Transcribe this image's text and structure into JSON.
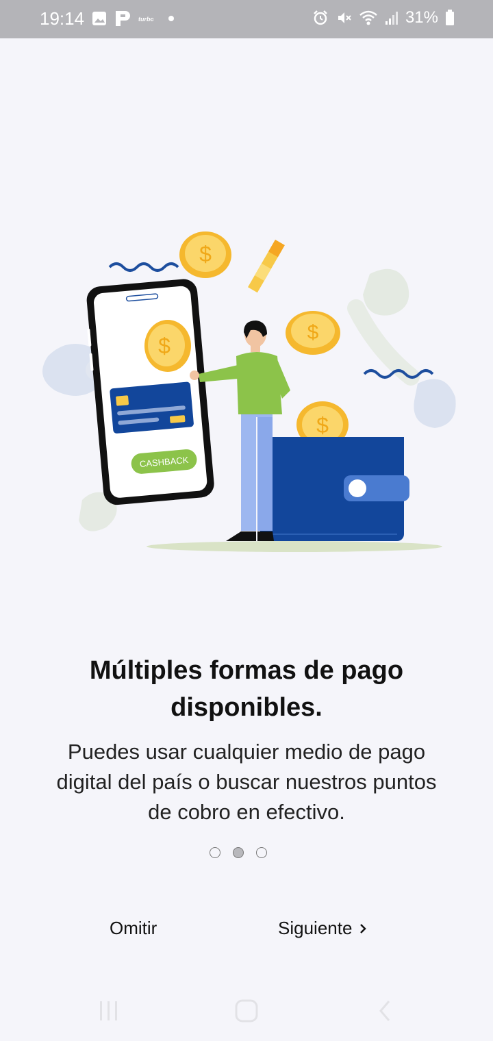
{
  "status_bar": {
    "time": "19:14",
    "battery": "31%",
    "icons": [
      "image-icon",
      "p-app-icon",
      "turbo-icon",
      "notification-dot-icon",
      "alarm-icon",
      "mute-icon",
      "wifi-icon",
      "signal-icon",
      "battery-icon"
    ]
  },
  "illustration": {
    "cashback_label": "CASHBACK",
    "accent_green": "#8cc34a",
    "accent_blue": "#12469b",
    "coin_color": "#f7c948"
  },
  "onboarding": {
    "title_line1": "Múltiples formas de pago",
    "title_line2": "disponibles.",
    "subtitle_line1": "Puedes usar cualquier medio de pago",
    "subtitle_line2": "digital del país o buscar nuestros puntos",
    "subtitle_line3": "de cobro en efectivo.",
    "page_total": 3,
    "page_current": 2
  },
  "actions": {
    "skip_label": "Omitir",
    "next_label": "Siguiente",
    "next_icon": "chevron-right-icon"
  },
  "nav": {
    "icons": [
      "recents-icon",
      "home-icon",
      "back-icon"
    ]
  }
}
